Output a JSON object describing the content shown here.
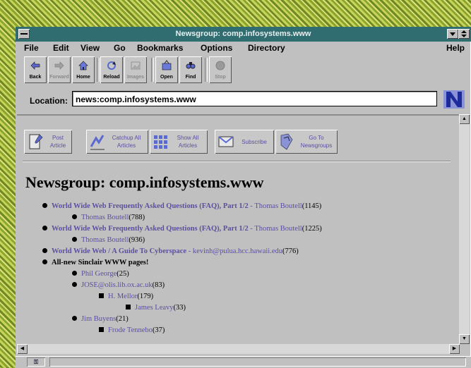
{
  "window": {
    "title": "Newsgroup: comp.infosystems.www"
  },
  "menu": [
    "File",
    "Edit",
    "View",
    "Go",
    "Bookmarks",
    "Options",
    "Directory",
    "Help"
  ],
  "toolbar": {
    "back": "Back",
    "forward": "Forward",
    "home": "Home",
    "reload": "Reload",
    "images": "Images",
    "open": "Open",
    "find": "Find",
    "stop": "Stop"
  },
  "location": {
    "label": "Location:",
    "url": "news:comp.infosystems.www"
  },
  "news_toolbar": {
    "post": "Post\nArticle",
    "catchup": "Catchup All\nArticles",
    "show_all": "Show All\nArticles",
    "subscribe": "Subscribe",
    "goto": "Go To\nNewsgroups"
  },
  "page": {
    "heading": "Newsgroup: comp.infosystems.www",
    "items": [
      {
        "subject": "World Wide Web Frequently Asked Questions (FAQ), Part 1/2",
        "author": " - Thomas Boutell",
        "count": "(1145)"
      },
      {
        "author": "Thomas Boutell",
        "count": "(788)"
      },
      {
        "subject": "World Wide Web Frequently Asked Questions (FAQ), Part 1/2",
        "author": " - Thomas Boutell",
        "count": "(1225)"
      },
      {
        "author": "Thomas Boutell",
        "count": "(936)"
      },
      {
        "subject": "World Wide Web / A Guide To Cyberspace",
        "author": " - kevinh@pulua.hcc.hawaii.edu",
        "count": "(776)"
      },
      {
        "subject": "All-new Sinclair WWW pages!"
      },
      {
        "author": "Phil George",
        "count": "(25)"
      },
      {
        "author": "JOSE@olis.lib.ox.ac.uk",
        "count": "(83)"
      },
      {
        "author": "H. Mellor",
        "count": "(179)"
      },
      {
        "author": "James Leavy",
        "count": "(33)"
      },
      {
        "author": "Jim Buyens",
        "count": "(21)"
      },
      {
        "author": "Frode Tennebo",
        "count": "(37)"
      }
    ]
  },
  "colors": {
    "titlebar": "#2f6d70",
    "link": "#5b4fa0",
    "window": "#c0c0c0"
  },
  "icons": [
    "back-icon",
    "forward-icon",
    "home-icon",
    "reload-icon",
    "images-icon",
    "open-icon",
    "find-icon",
    "stop-icon",
    "netscape-n-icon"
  ]
}
